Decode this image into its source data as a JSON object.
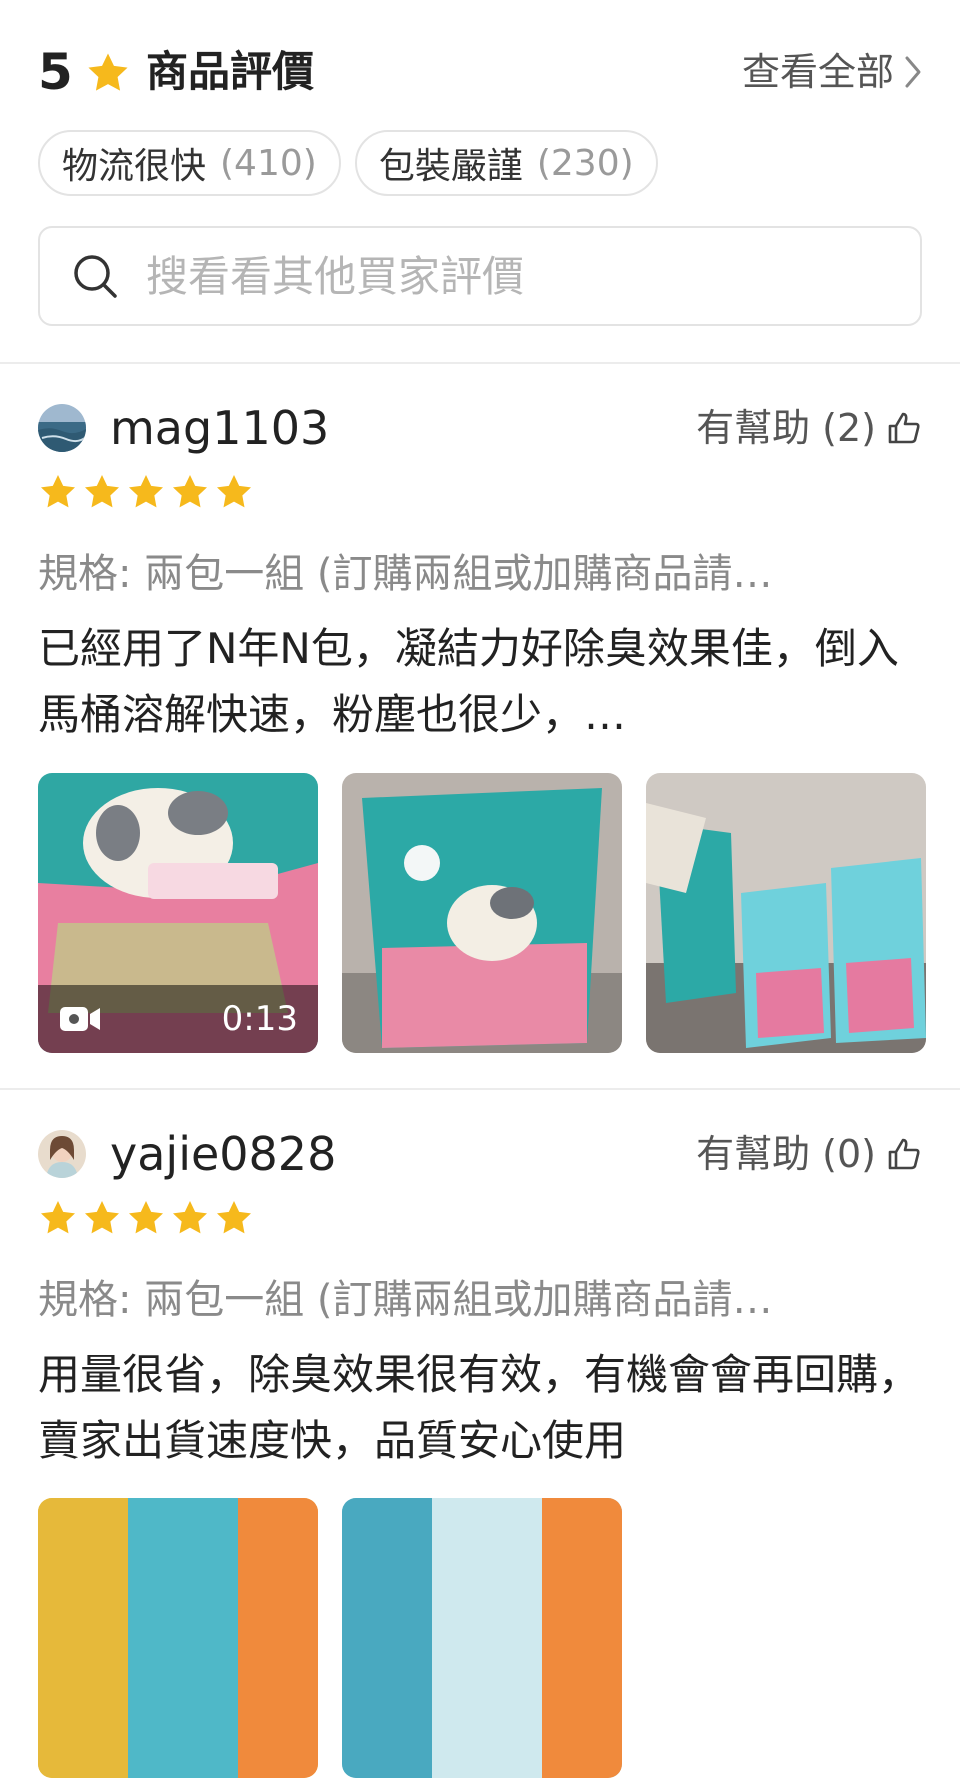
{
  "summary": {
    "rating": "5",
    "title": "商品評價",
    "view_all": "查看全部",
    "star_color": "#F6B91C"
  },
  "tags": [
    {
      "label": "物流很快",
      "count": "(410)"
    },
    {
      "label": "包裝嚴謹",
      "count": "(230)"
    }
  ],
  "search": {
    "placeholder": "搜看看其他買家評價"
  },
  "reviews": [
    {
      "username": "mag1103",
      "helpful": "有幫助 (2)",
      "stars": 5,
      "variation": "規格: 兩包一組 (訂購兩組或加購商品請…",
      "comment": "已經用了N年N包，凝結力好除臭效果佳，倒入馬桶溶解快速，粉塵也很少，…",
      "media": [
        {
          "type": "video",
          "duration": "0:13"
        },
        {
          "type": "image"
        },
        {
          "type": "image"
        }
      ]
    },
    {
      "username": "yajie0828",
      "helpful": "有幫助 (0)",
      "stars": 5,
      "variation": "規格: 兩包一組 (訂購兩組或加購商品請…",
      "comment": "用量很省，除臭效果很有效，有機會會再回購，賣家出貨速度快，品質安心使用",
      "media": [
        {
          "type": "image"
        },
        {
          "type": "image"
        }
      ]
    }
  ]
}
